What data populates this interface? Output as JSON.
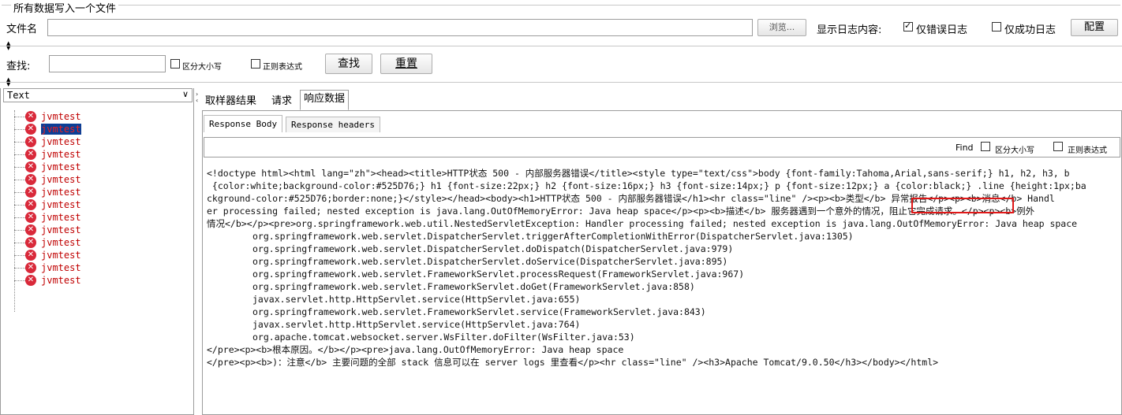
{
  "top": {
    "group_title": "所有数据写入一个文件",
    "filename_label": "文件名",
    "filename_value": "",
    "browse_label": "浏览...",
    "log_label": "显示日志内容:",
    "errors_only_label": "仅错误日志",
    "success_only_label": "仅成功日志",
    "configure_label": "配置"
  },
  "search": {
    "label": "查找:",
    "value": "",
    "case_label": "区分大小写",
    "regex_label": "正则表达式",
    "find_btn": "查找",
    "reset_btn": "重置"
  },
  "left": {
    "renderer": "Text",
    "items": [
      "jvmtest",
      "jvmtest",
      "jvmtest",
      "jvmtest",
      "jvmtest",
      "jvmtest",
      "jvmtest",
      "jvmtest",
      "jvmtest",
      "jvmtest",
      "jvmtest",
      "jvmtest",
      "jvmtest",
      "jvmtest"
    ]
  },
  "right": {
    "tabs": [
      "取样器结果",
      "请求",
      "响应数据"
    ],
    "subtabs": [
      "Response Body",
      "Response headers"
    ],
    "find_label": "Find",
    "case_label": "区分大小写",
    "regex_label": "正则表达式",
    "response_lines": [
      "<!doctype html><html lang=\"zh\"><head><title>HTTP状态 500 - 内部服务器错误</title><style type=\"text/css\">body {font-family:Tahoma,Arial,sans-serif;} h1, h2, h3, b",
      " {color:white;background-color:#525D76;} h1 {font-size:22px;} h2 {font-size:16px;} h3 {font-size:14px;} p {font-size:12px;} a {color:black;} .line {height:1px;ba",
      "ckground-color:#525D76;border:none;}</style></head><body><h1>HTTP状态 500 - 内部服务器错误</h1><hr class=\"line\" /><p><b>类型</b> 异常报告</p><p><b>消息</b> Handl",
      "er processing failed; nested exception is java.lang.OutOfMemoryError: Java heap space</p><p><b>描述</b> 服务器遇到一个意外的情况，阻止它完成请求。</p><p><b>例外",
      "情况</b></p><pre>org.springframework.web.util.NestedServletException: Handler processing failed; nested exception is java.lang.OutOfMemoryError: Java heap space",
      "\torg.springframework.web.servlet.DispatcherServlet.triggerAfterCompletionWithError(DispatcherServlet.java:1305)",
      "\torg.springframework.web.servlet.DispatcherServlet.doDispatch(DispatcherServlet.java:979)",
      "\torg.springframework.web.servlet.DispatcherServlet.doService(DispatcherServlet.java:895)",
      "\torg.springframework.web.servlet.FrameworkServlet.processRequest(FrameworkServlet.java:967)",
      "\torg.springframework.web.servlet.FrameworkServlet.doGet(FrameworkServlet.java:858)",
      "\tjavax.servlet.http.HttpServlet.service(HttpServlet.java:655)",
      "\torg.springframework.web.servlet.FrameworkServlet.service(FrameworkServlet.java:843)",
      "\tjavax.servlet.http.HttpServlet.service(HttpServlet.java:764)",
      "\torg.apache.tomcat.websocket.server.WsFilter.doFilter(WsFilter.java:53)",
      "</pre><p><b>根本原因。</b></p><pre>java.lang.OutOfMemoryError: Java heap space",
      "</pre><p><b>)：注意</b> 主要问题的全部 stack 信息可以在 server logs 里查看</p><hr class=\"line\" /><h3>Apache Tomcat/9.0.50</h3></body></html>"
    ]
  },
  "colors": {
    "highlight": "#e01818",
    "error_icon": "#d9293a",
    "selected_bg": "#0b3f96"
  }
}
